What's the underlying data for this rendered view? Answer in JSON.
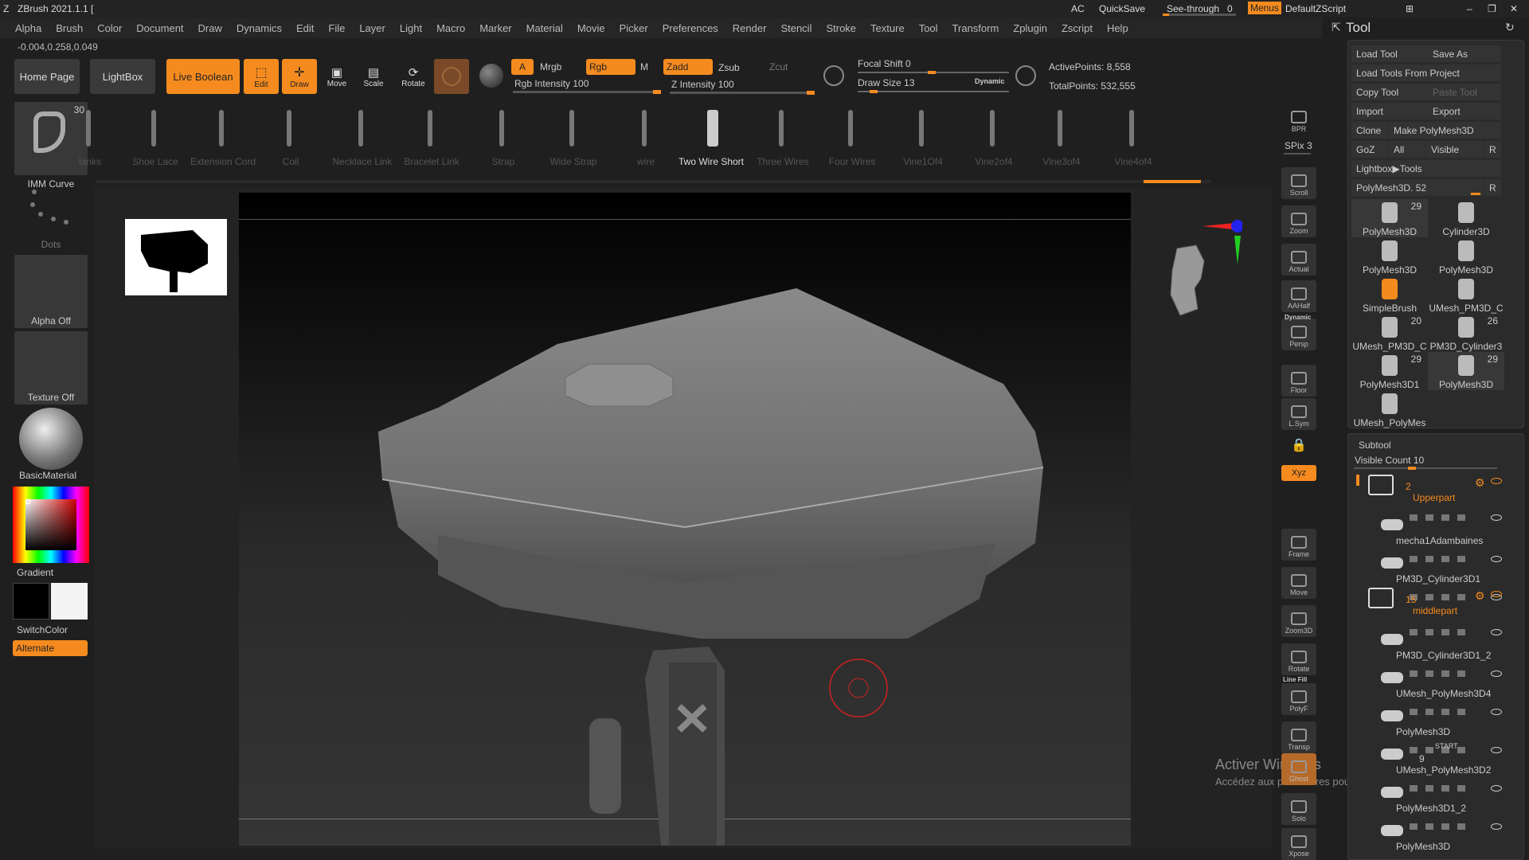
{
  "app": {
    "title": "ZBrush 2021.1.1 [",
    "ac": "AC",
    "quicksave": "QuickSave",
    "see_through": "See-through",
    "see_through_value": "0",
    "menus": "Menus",
    "script": "DefaultZScript"
  },
  "menu": [
    "Alpha",
    "Brush",
    "Color",
    "Document",
    "Draw",
    "Dynamics",
    "Edit",
    "File",
    "Layer",
    "Light",
    "Macro",
    "Marker",
    "Material",
    "Movie",
    "Picker",
    "Preferences",
    "Render",
    "Stencil",
    "Stroke",
    "Texture",
    "Tool",
    "Transform",
    "Zplugin",
    "Zscript",
    "Help"
  ],
  "coords": "-0.004,0.258,0.049",
  "toolbar": {
    "home": "Home Page",
    "lightbox": "LightBox",
    "live_boolean": "Live Boolean",
    "edit": "Edit",
    "draw": "Draw",
    "move": "Move",
    "scale": "Scale",
    "rotate": "Rotate",
    "a": "A",
    "mrgb": "Mrgb",
    "rgb": "Rgb",
    "m": "M",
    "zadd": "Zadd",
    "zsub": "Zsub",
    "zcut": "Zcut",
    "rgb_intensity": "Rgb Intensity 100",
    "z_intensity": "Z Intensity 100",
    "focal_shift": "Focal Shift 0",
    "draw_size": "Draw Size 13",
    "dynamic": "Dynamic",
    "active_points": "ActivePoints: 8,558",
    "total_points": "TotalPoints: 532,555"
  },
  "left": {
    "brush_count": "30",
    "brush_name": "IMM Curve",
    "dots": "Dots",
    "alpha": "Alpha Off",
    "texture": "Texture Off",
    "material": "BasicMaterial",
    "gradient": "Gradient",
    "switchcolor": "SwitchColor",
    "alternate": "Alternate"
  },
  "shelf": [
    "lanks",
    "Shoe Lace",
    "Extension Cord",
    "Coil",
    "Necklace Link",
    "Bracelet Link",
    "Strap",
    "Wide Strap",
    "wire",
    "Two Wire Short",
    "Three Wires",
    "Four Wires",
    "Vine1Of4",
    "Vine2of4",
    "Vine3of4",
    "Vine4of4"
  ],
  "right_toolbar": [
    "BPR",
    "SPix 3",
    "Scroll",
    "Zoom",
    "Actual",
    "AAHalf",
    "Persp",
    "Floor",
    "L.Sym",
    "Lock",
    "Xyz",
    "Frame",
    "Move",
    "Zoom3D",
    "Rotate",
    "PolyF",
    "Transp",
    "Ghost",
    "Solo",
    "Xpose"
  ],
  "right_toolbar_extra": {
    "dynamic": "Dynamic",
    "line_fill": "Line Fill"
  },
  "tool": {
    "title": "Tool",
    "load": "Load Tool",
    "save_as": "Save As",
    "load_project": "Load Tools From Project",
    "copy": "Copy Tool",
    "paste": "Paste Tool",
    "import": "Import",
    "export": "Export",
    "clone": "Clone",
    "make_polymesh": "Make PolyMesh3D",
    "goz": "GoZ",
    "all": "All",
    "visible": "Visible",
    "r": "R",
    "lightbox_tools": "Lightbox▶Tools",
    "current": "PolyMesh3D. 52"
  },
  "tools": [
    {
      "name": "PolyMesh3D",
      "count": "29"
    },
    {
      "name": "Cylinder3D",
      "count": ""
    },
    {
      "name": "PolyMesh3D",
      "count": ""
    },
    {
      "name": "PolyMesh3D",
      "count": ""
    },
    {
      "name": "SimpleBrush",
      "count": ""
    },
    {
      "name": "UMesh_PM3D_C",
      "count": ""
    },
    {
      "name": "UMesh_PM3D_C",
      "count": "20"
    },
    {
      "name": "PM3D_Cylinder3",
      "count": "26"
    },
    {
      "name": "PolyMesh3D1",
      "count": "29"
    },
    {
      "name": "PolyMesh3D",
      "count": "29"
    },
    {
      "name": "UMesh_PolyMes",
      "count": ""
    }
  ],
  "subtool": {
    "title": "Subtool",
    "visible_count": "Visible Count 10",
    "folders": [
      {
        "count": "2",
        "name": "Upperpart"
      },
      {
        "count": "15",
        "name": "middlepart"
      }
    ],
    "items": [
      "mecha1Adambaines",
      "PM3D_Cylinder3D1",
      "PM3D_Cylinder3D1_2",
      "UMesh_PolyMesh3D4",
      "PolyMesh3D",
      "UMesh_PolyMesh3D2",
      "PolyMesh3D1_2",
      "PolyMesh3D"
    ],
    "start": "START",
    "nine": "9"
  },
  "watermark": {
    "line1": "Activer Windows",
    "line2": "Accédez aux paramètres pour activer Windows."
  },
  "colors": {
    "accent": "#f58b1f",
    "bg": "#1f1f1f",
    "panel": "#2b2b2b"
  }
}
